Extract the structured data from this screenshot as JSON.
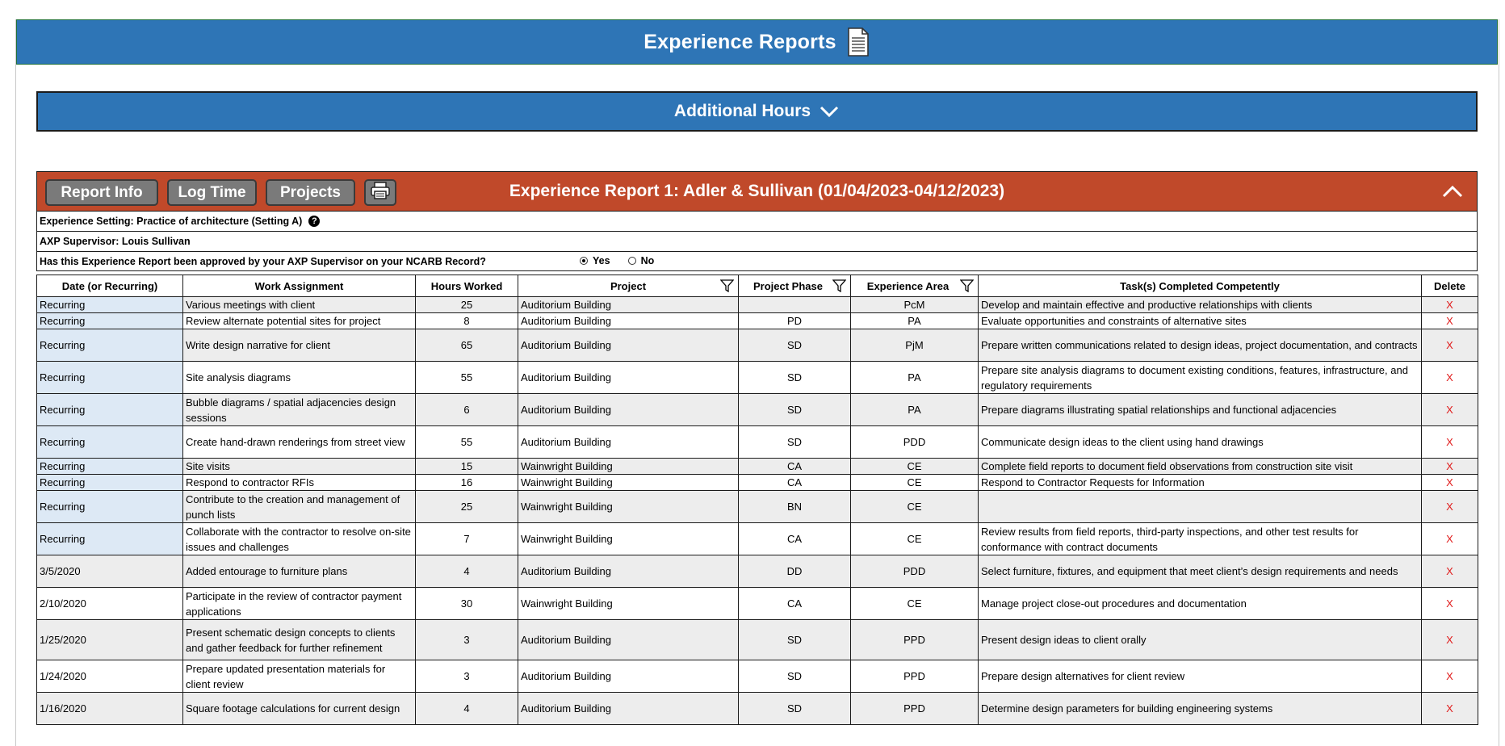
{
  "banner": {
    "title": "Experience Reports",
    "icon": "document-icon"
  },
  "additional_hours": {
    "label": "Additional Hours",
    "icon": "chevron-down-icon"
  },
  "report": {
    "title": "Experience Report 1: Adler & Sullivan (01/04/2023-04/12/2023)",
    "buttons": {
      "report_info": "Report Info",
      "log_time": "Log Time",
      "projects": "Projects",
      "print_icon": "printer-icon"
    },
    "collapse_icon": "chevron-up-icon",
    "accent_color": "#c0492a"
  },
  "info": {
    "setting": "Experience Setting: Practice of architecture (Setting A)",
    "supervisor": "AXP Supervisor: Louis Sullivan",
    "approval_question": "Has this Experience Report been approved by your AXP Supervisor on your NCARB Record?",
    "yes_label": "Yes",
    "no_label": "No",
    "selected": "Yes"
  },
  "table": {
    "headers": [
      "Date (or Recurring)",
      "Work Assignment",
      "Hours Worked",
      "Project",
      "Project Phase",
      "Experience Area",
      "Task(s) Completed Competently",
      "Delete"
    ],
    "delete_mark": "X",
    "rows": [
      {
        "date": "Recurring",
        "work": "Various meetings with client",
        "hours": "25",
        "project": "Auditorium Building",
        "phase": "",
        "area": "PcM",
        "task": "Develop and maintain effective and productive relationships with clients"
      },
      {
        "date": "Recurring",
        "work": "Review alternate potential sites for project",
        "hours": "8",
        "project": "Auditorium Building",
        "phase": "PD",
        "area": "PA",
        "task": "Evaluate opportunities and constraints of alternative sites"
      },
      {
        "date": "Recurring",
        "work": "Write design narrative for client",
        "hours": "65",
        "project": "Auditorium Building",
        "phase": "SD",
        "area": "PjM",
        "task": "Prepare written communications related to design ideas, project documentation, and contracts"
      },
      {
        "date": "Recurring",
        "work": "Site analysis diagrams",
        "hours": "55",
        "project": "Auditorium Building",
        "phase": "SD",
        "area": "PA",
        "task": "Prepare site analysis diagrams to document existing conditions, features, infrastructure, and regulatory requirements"
      },
      {
        "date": "Recurring",
        "work": "Bubble diagrams / spatial adjacencies design sessions",
        "hours": "6",
        "project": "Auditorium Building",
        "phase": "SD",
        "area": "PA",
        "task": "Prepare diagrams illustrating spatial relationships and functional adjacencies"
      },
      {
        "date": "Recurring",
        "work": "Create hand-drawn renderings from street view",
        "hours": "55",
        "project": "Auditorium Building",
        "phase": "SD",
        "area": "PDD",
        "task": "Communicate design ideas to the client using hand drawings"
      },
      {
        "date": "Recurring",
        "work": "Site visits",
        "hours": "15",
        "project": "Wainwright Building",
        "phase": "CA",
        "area": "CE",
        "task": "Complete field reports to document field observations from construction site visit"
      },
      {
        "date": "Recurring",
        "work": "Respond to contractor RFIs",
        "hours": "16",
        "project": "Wainwright Building",
        "phase": "CA",
        "area": "CE",
        "task": "Respond to Contractor Requests for Information"
      },
      {
        "date": "Recurring",
        "work": "Contribute to the creation and management of punch lists",
        "hours": "25",
        "project": "Wainwright Building",
        "phase": "BN",
        "area": "CE",
        "task": ""
      },
      {
        "date": "Recurring",
        "work": "Collaborate with the contractor to resolve on-site issues and challenges",
        "hours": "7",
        "project": "Wainwright Building",
        "phase": "CA",
        "area": "CE",
        "task": "Review results from field reports, third-party inspections, and other test results for conformance with contract documents"
      },
      {
        "date": "3/5/2020",
        "work": "Added entourage to furniture plans",
        "hours": "4",
        "project": "Auditorium Building",
        "phase": "DD",
        "area": "PDD",
        "task": "Select furniture, fixtures, and equipment that meet client’s design requirements and needs"
      },
      {
        "date": "2/10/2020",
        "work": "Participate in the review of contractor payment applications",
        "hours": "30",
        "project": "Wainwright Building",
        "phase": "CA",
        "area": "CE",
        "task": "Manage project close-out procedures and documentation"
      },
      {
        "date": "1/25/2020",
        "work": "Present schematic design concepts to clients and gather feedback for further refinement",
        "hours": "3",
        "project": "Auditorium Building",
        "phase": "SD",
        "area": "PPD",
        "task": "Present design ideas to client orally"
      },
      {
        "date": "1/24/2020",
        "work": "Prepare updated presentation materials for client review",
        "hours": "3",
        "project": "Auditorium Building",
        "phase": "SD",
        "area": "PPD",
        "task": "Prepare design alternatives for client review"
      },
      {
        "date": "1/16/2020",
        "work": "Square footage calculations for current design",
        "hours": "4",
        "project": "Auditorium Building",
        "phase": "SD",
        "area": "PPD",
        "task": "Determine design parameters for building engineering systems"
      }
    ]
  }
}
